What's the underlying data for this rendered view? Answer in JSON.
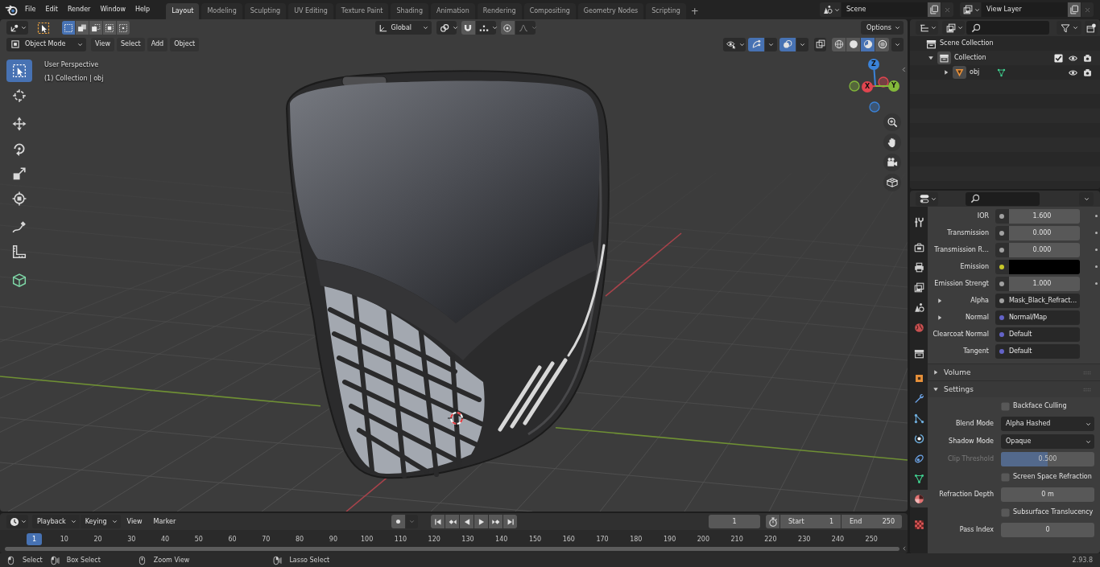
{
  "top_bar": {
    "menus": [
      "File",
      "Edit",
      "Render",
      "Window",
      "Help"
    ],
    "workspaces": [
      {
        "label": "Layout",
        "selected": true
      },
      {
        "label": "Modeling",
        "selected": false
      },
      {
        "label": "Sculpting",
        "selected": false
      },
      {
        "label": "UV Editing",
        "selected": false
      },
      {
        "label": "Texture Paint",
        "selected": false
      },
      {
        "label": "Shading",
        "selected": false
      },
      {
        "label": "Animation",
        "selected": false
      },
      {
        "label": "Rendering",
        "selected": false
      },
      {
        "label": "Compositing",
        "selected": false
      },
      {
        "label": "Geometry Nodes",
        "selected": false
      },
      {
        "label": "Scripting",
        "selected": false
      }
    ],
    "add_workspace": "+",
    "scene": "Scene",
    "view_layer": "View Layer"
  },
  "tool_header": {
    "select_modes": [
      {
        "kind": "set",
        "selected": true
      },
      {
        "kind": "extend",
        "selected": false
      },
      {
        "kind": "subtract",
        "selected": false
      },
      {
        "kind": "invert",
        "selected": false
      },
      {
        "kind": "intersect",
        "selected": false
      }
    ],
    "orientation": "Global",
    "options": "Options"
  },
  "viewport_header": {
    "mode": "Object Mode",
    "menus": [
      "View",
      "Select",
      "Add",
      "Object"
    ],
    "gizmos": true,
    "overlays": true,
    "xray": false,
    "shading": [
      {
        "kind": "wireframe",
        "selected": false
      },
      {
        "kind": "solid",
        "selected": false
      },
      {
        "kind": "material",
        "selected": true
      },
      {
        "kind": "rendered",
        "selected": false
      }
    ]
  },
  "viewport": {
    "view_name": "User Perspective",
    "context": "(1) Collection | obj",
    "tools": [
      {
        "kind": "select_box",
        "selected": true
      },
      {
        "kind": "cursor",
        "selected": false
      },
      {
        "kind": "move",
        "selected": false
      },
      {
        "kind": "rotate",
        "selected": false
      },
      {
        "kind": "scale",
        "selected": false
      },
      {
        "kind": "transform",
        "selected": false
      },
      {
        "kind": "annotate",
        "selected": false
      },
      {
        "kind": "measure",
        "selected": false
      },
      {
        "kind": "add_cube",
        "selected": false
      }
    ],
    "axes": [
      {
        "label": "Z",
        "color": "#3b83d9"
      },
      {
        "label": "X",
        "color": "#e0454f"
      },
      {
        "label": "Y",
        "color": "#83b83a"
      }
    ]
  },
  "outliner": {
    "items": [
      {
        "kind": "scene_collection",
        "label": "Scene Collection",
        "children": [
          {
            "kind": "collection",
            "label": "Collection",
            "expanded": true,
            "checked": true,
            "visible": true,
            "children": [
              {
                "kind": "mesh_object",
                "label": "obj",
                "expanded": false,
                "visible": true
              }
            ]
          }
        ]
      }
    ]
  },
  "properties": {
    "tabs": [
      {
        "kind": "tool",
        "selected": false
      },
      {
        "kind": "render",
        "selected": false
      },
      {
        "kind": "output",
        "selected": false
      },
      {
        "kind": "view_layer",
        "selected": false
      },
      {
        "kind": "scene",
        "selected": false
      },
      {
        "kind": "world",
        "selected": false
      },
      {
        "kind": "collection",
        "selected": false
      },
      {
        "kind": "object",
        "selected": false
      },
      {
        "kind": "modifiers",
        "selected": false
      },
      {
        "kind": "particles",
        "selected": false
      },
      {
        "kind": "physics",
        "selected": false
      },
      {
        "kind": "constraints",
        "selected": false
      },
      {
        "kind": "data",
        "selected": false
      },
      {
        "kind": "material",
        "selected": true
      },
      {
        "kind": "texture",
        "selected": false
      }
    ],
    "inputs": [
      {
        "kind": "value",
        "label": "IOR",
        "color": "#a1a1a1",
        "value": "1.600",
        "decorator": true
      },
      {
        "kind": "value",
        "label": "Transmission",
        "color": "#a1a1a1",
        "value": "0.000",
        "decorator": true
      },
      {
        "kind": "value",
        "label": "Transmission R…",
        "color": "#a1a1a1",
        "value": "0.000",
        "decorator": true
      },
      {
        "kind": "color",
        "label": "Emission",
        "color": "#c7c729",
        "swatch": {
          "color": "#000000"
        },
        "decorator": true
      },
      {
        "kind": "value",
        "label": "Emission Strengt",
        "color": "#a1a1a1",
        "value": "1.000",
        "decorator": true
      },
      {
        "kind": "link",
        "label": "Alpha",
        "color": "#a1a1a1",
        "value": "Mask_Black_Refract…",
        "expanded": false
      },
      {
        "kind": "link",
        "label": "Normal",
        "color": "#6363c7",
        "value": "Normal/Map",
        "expanded": false
      },
      {
        "kind": "link",
        "label": "Clearcoat Normal",
        "color": "#6363c7",
        "value": "Default"
      },
      {
        "kind": "link",
        "label": "Tangent",
        "color": "#6363c7",
        "value": "Default"
      }
    ],
    "panels": [
      {
        "label": "Volume",
        "expanded": false
      },
      {
        "label": "Settings",
        "expanded": true,
        "rows": [
          {
            "kind": "checkbox",
            "label": "Backface Culling",
            "checked": false
          },
          {
            "kind": "dropdown",
            "label": "Blend Mode",
            "value": "Alpha Hashed"
          },
          {
            "kind": "dropdown",
            "label": "Shadow Mode",
            "value": "Opaque"
          },
          {
            "kind": "slider",
            "label": "Clip Threshold",
            "value": "0.500",
            "level": 0.5,
            "disabled": true
          },
          {
            "kind": "checkbox",
            "label": "Screen Space Refraction",
            "checked": false
          },
          {
            "kind": "number",
            "label": "Refraction Depth",
            "value": "0 m"
          },
          {
            "kind": "checkbox",
            "label": "Subsurface Translucency",
            "checked": false
          },
          {
            "kind": "number",
            "label": "Pass Index",
            "value": "0"
          }
        ]
      }
    ]
  },
  "timeline": {
    "menus": [
      {
        "kind": "dropdown",
        "label": "Playback"
      },
      {
        "kind": "dropdown",
        "label": "Keying"
      },
      {
        "kind": "menu",
        "label": "View"
      },
      {
        "kind": "menu",
        "label": "Marker"
      }
    ],
    "auto_keying": false,
    "current_frame": "1",
    "start_label": "Start",
    "start": "1",
    "end_label": "End",
    "end": "250",
    "playhead": "1",
    "ruler": [
      "10",
      "20",
      "30",
      "40",
      "50",
      "60",
      "70",
      "80",
      "90",
      "100",
      "110",
      "120",
      "130",
      "140",
      "150",
      "160",
      "170",
      "180",
      "190",
      "200",
      "210",
      "220",
      "230",
      "240",
      "250"
    ]
  },
  "status_bar": {
    "hints": [
      {
        "kind": "click",
        "label": "Select"
      },
      {
        "kind": "drag",
        "label": "Box Select"
      },
      {
        "kind": "middle",
        "label": "Zoom View"
      },
      {
        "kind": "right_drag",
        "label": "Lasso Select"
      }
    ],
    "version": "2.93.8"
  }
}
